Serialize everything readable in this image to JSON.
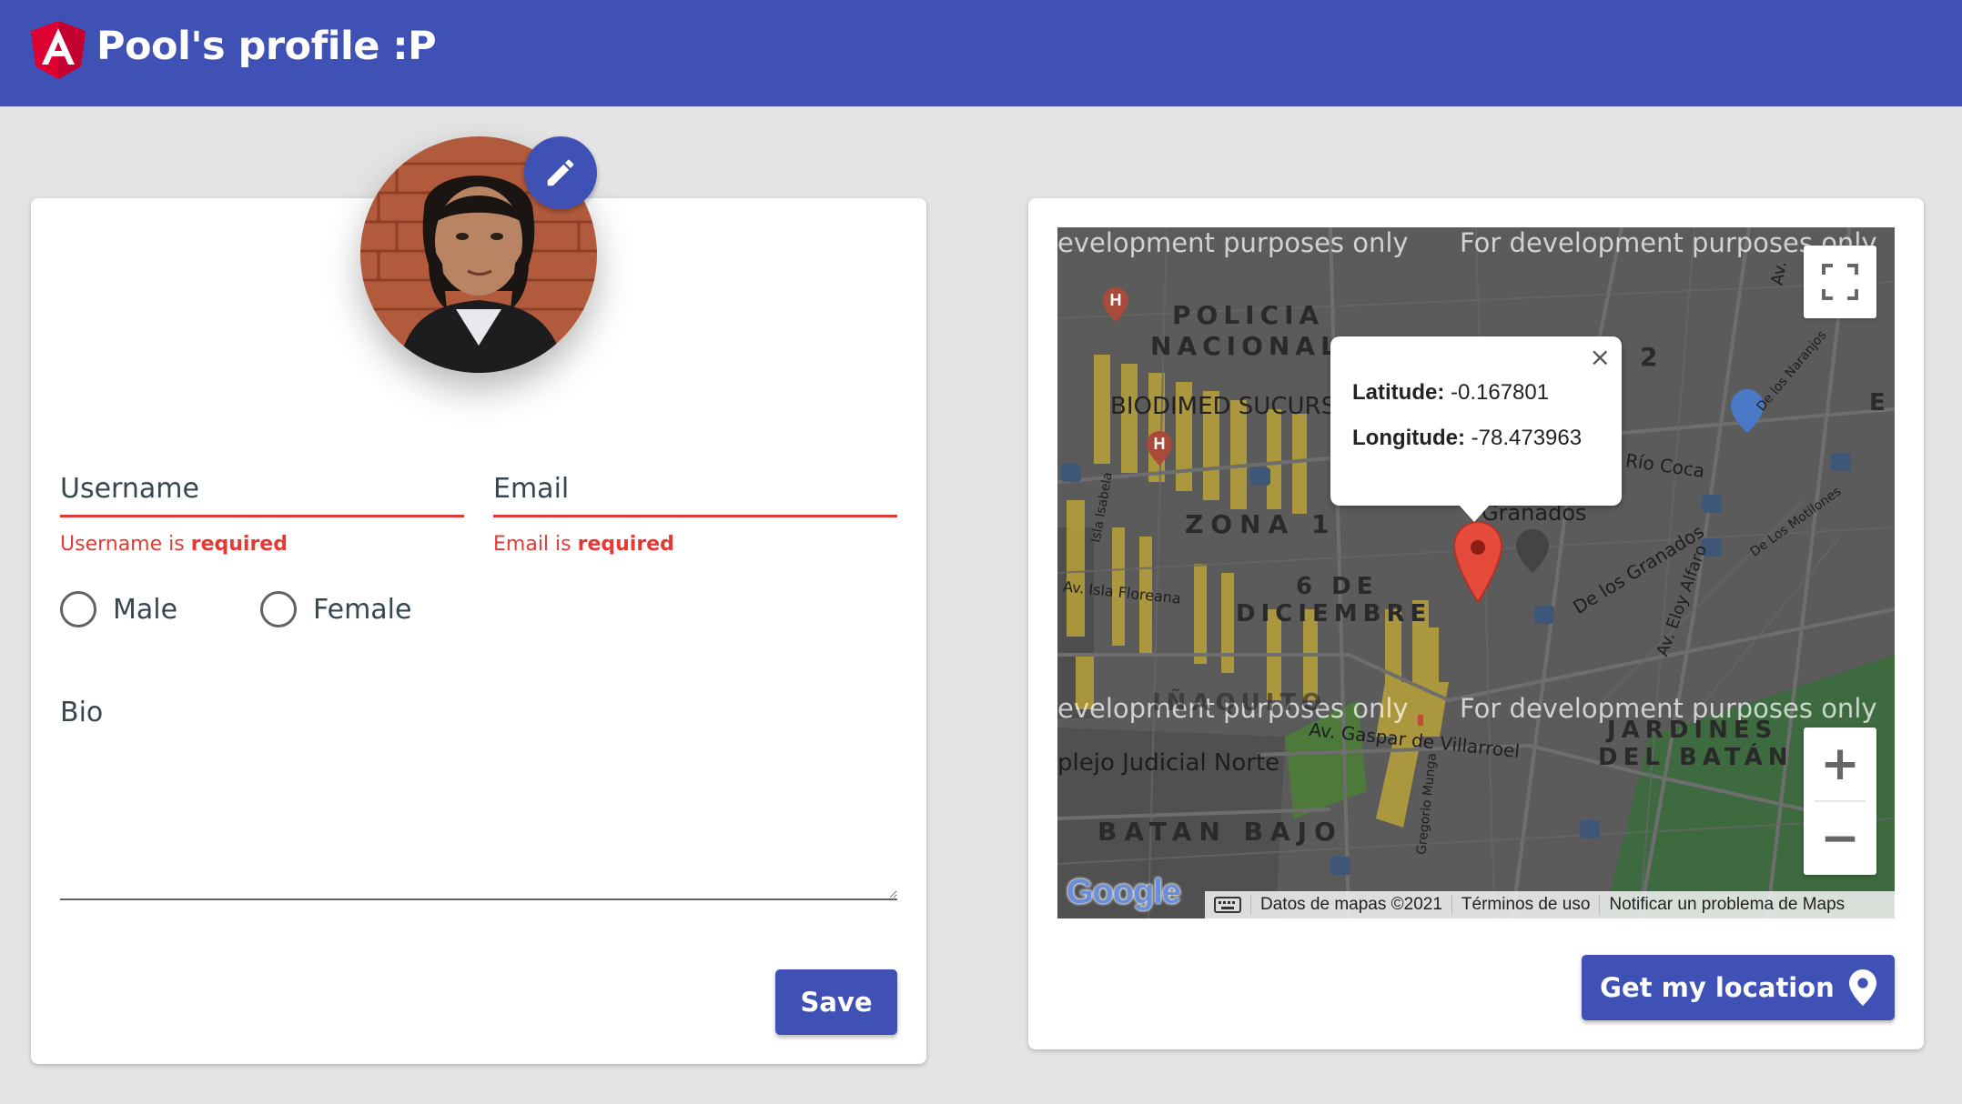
{
  "header": {
    "title": "Pool's profile :P",
    "logo_icon": "angular-logo-icon",
    "background_color": "#3f51b5"
  },
  "profile_form": {
    "avatar_icon": "user-avatar",
    "edit_avatar_icon": "pencil-icon",
    "username": {
      "label": "Username",
      "value": "",
      "error_prefix": "Username is ",
      "error_emphasis": "required"
    },
    "email": {
      "label": "Email",
      "value": "",
      "error_prefix": "Email is ",
      "error_emphasis": "required"
    },
    "gender_options": [
      "Male",
      "Female"
    ],
    "gender_selected": null,
    "bio": {
      "label": "Bio",
      "value": ""
    },
    "save_label": "Save",
    "error_color": "#e53935"
  },
  "map_panel": {
    "watermarks": [
      "evelopment purposes only",
      "For development purposes only",
      "evelopment purposes only",
      "For development purposes only"
    ],
    "place_labels": {
      "policia_1": "POLICIA",
      "policia_2": "NACIONAL",
      "biodimed": "BIODIMED SUCURS",
      "zona1": "ZONA 1",
      "seis": "6 DE",
      "diciembre": "DICIEMBRE",
      "granados": "Granados",
      "rio_coca": "Río Coca",
      "de_los_granados": "De los Granados",
      "eloy_alfaro": "Av. Eloy Alfaro",
      "isla_floreana": "Av. Isla Floreana",
      "isla_isabela": "Isla Isabela",
      "gaspar": "Av. Gaspar de Villarroel",
      "jardines": "JARDINES",
      "del_batan": "DEL BATÁN",
      "complejo": "plejo Judicial Norte",
      "batan_bajo": "BATAN BAJO",
      "inaquito": "IÑAQUITO",
      "gregorio": "Gregorio Munga",
      "naranjos": "De los Naranjos",
      "motilones": "De Los Motilones",
      "num_2": "2",
      "e_frag": "E",
      "av_frag": "Av."
    },
    "info_window": {
      "latitude_label": "Latitude:",
      "latitude_value": "-0.167801",
      "longitude_label": "Longitude:",
      "longitude_value": "-78.473963",
      "close_symbol": "×"
    },
    "footer": {
      "map_data": "Datos de mapas ©2021",
      "terms": "Términos de uso",
      "report": "Notificar un problema de Maps"
    },
    "google_logo": "Google",
    "zoom_in_symbol": "+",
    "zoom_out_symbol": "−",
    "marker_icon": "map-pin-icon",
    "get_location_label": "Get my location",
    "get_location_icon": "location-pin-icon"
  }
}
